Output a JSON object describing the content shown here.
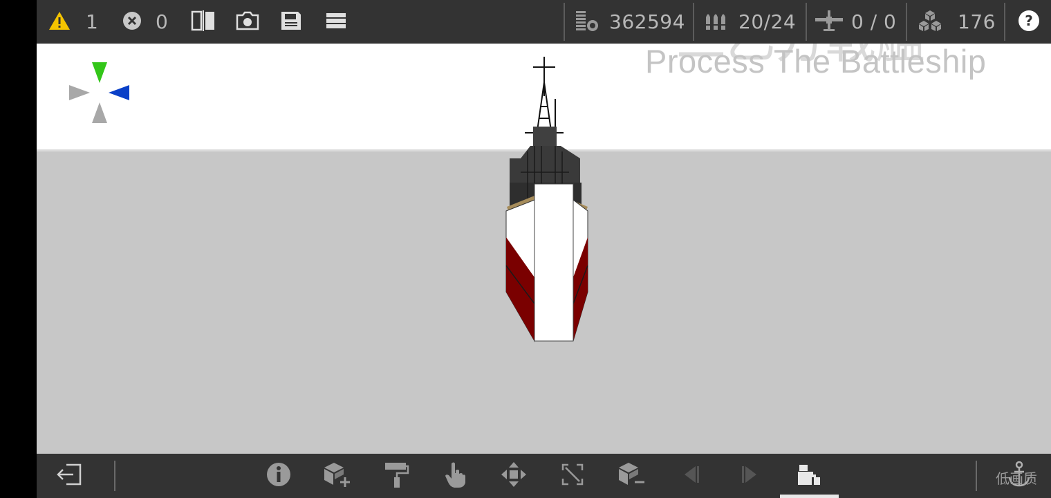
{
  "top_bar": {
    "warning_count": "1",
    "error_count": "0",
    "cost": "362594",
    "weapons": "20/24",
    "aircraft": "0 / 0",
    "parts": "176",
    "icons": {
      "warning": "warning-icon",
      "error": "error-icon",
      "mirror": "mirror-icon",
      "screenshot": "camera-icon",
      "save": "save-icon",
      "menu": "menu-icon",
      "cost": "cost-icon",
      "weapons": "ammo-icon",
      "aircraft": "aircraft-icon",
      "parts": "parts-icon",
      "help": "help-icon"
    }
  },
  "viewport": {
    "watermark_title": "Process The Battleship",
    "watermark_cjk": "二乙方戰艦"
  },
  "bottom_bar": {
    "quality_label": "低画质",
    "tools": [
      "exit",
      "info",
      "add-part",
      "paint",
      "select",
      "move",
      "transform",
      "remove-part",
      "step-back",
      "step-forward",
      "build-mode"
    ],
    "active_tool": "build-mode"
  },
  "colors": {
    "bar": "#333333",
    "sky": "#ffffff",
    "sea": "#c7c7c7",
    "hull_red": "#7a0000",
    "deck": "#a68c5a",
    "superstructure": "#333333",
    "gizmo_green": "#33c619",
    "gizmo_blue": "#0a40c8",
    "warning_yellow": "#f5c400"
  }
}
